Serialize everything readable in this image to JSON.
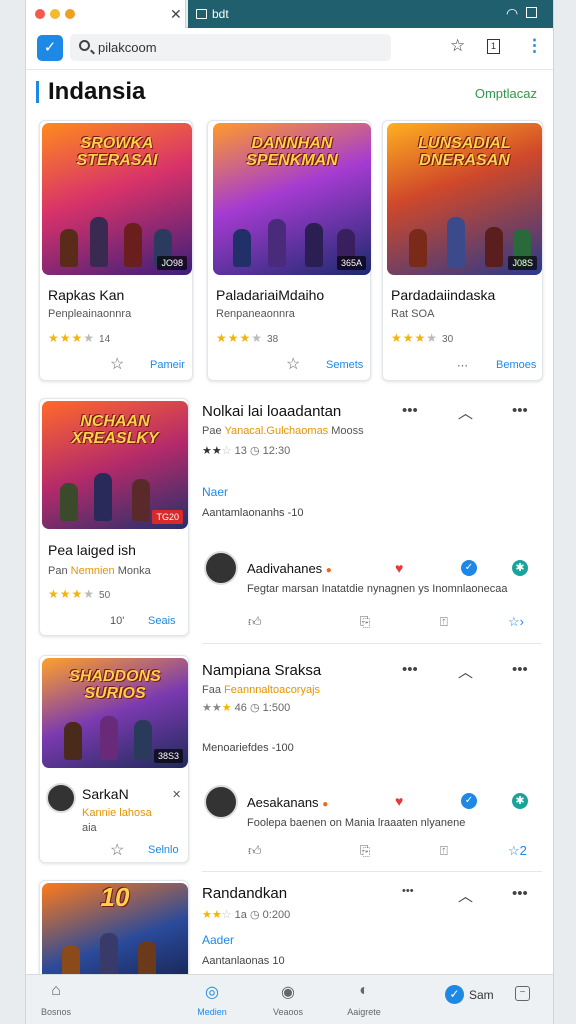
{
  "window": {
    "tab_title": "bdt",
    "search": {
      "value": "pilakcoom"
    }
  },
  "header": {
    "title": "Indansia",
    "link": "Omptlacaz"
  },
  "top_cards": [
    {
      "art_title": "SROWKA STERASAI",
      "badge": "JO98",
      "name": "Rapkas Kan",
      "sub": "Penpleainaonnra",
      "rating": "14",
      "action": "Pameir"
    },
    {
      "art_title": "DANNHAN SPENKMAN",
      "badge": "365A",
      "name": "PaladariaiMdaiho",
      "sub": "Renpaneaonnra",
      "rating": "38",
      "action": "Semets"
    },
    {
      "art_title": "LUNSADIAL DNERASAN",
      "badge": "J08S",
      "name": "Pardadaiindaska",
      "sub": "Rat SOA",
      "rating": "30",
      "action": "Bemoes"
    }
  ],
  "list_items": [
    {
      "art_title": "NCHAAN XREASLKY",
      "badge": "TG20",
      "card_name": "Pea laiged ish",
      "card_sub_prefix": "Pan",
      "card_sub_hl": "Nemnien",
      "card_sub_suffix": "Monka",
      "card_rating": "50",
      "card_rating_prefix": "10'",
      "card_action": "Seais",
      "title": "Nolkai lai loaadantan",
      "sub_prefix": "Pae",
      "sub_hl": "Yanacal.Gulchaomas",
      "sub_suffix": "Mooss",
      "rating": "13",
      "count": "12:30",
      "link": "Naer",
      "desc": "Aantamlaonanhs -10",
      "user": "Aadivahanes",
      "comment": "Fegtar marsan Inatatdie nynagnen ys Inomnlaonecaa"
    },
    {
      "art_title": "SHADDONS SURIOS",
      "badge": "38S3",
      "card_name": "SarkaN",
      "card_sub_prefix": "",
      "card_sub_hl": "Kannie lahosa",
      "card_sub_suffix": "aia",
      "card_action": "Selnlo",
      "title": "Nampiana Sraksa",
      "sub_prefix": "Faa",
      "sub_hl": "Feannnaltoacoryajs",
      "sub_suffix": "",
      "rating": "46",
      "count": "1:500",
      "desc": "Menoariefdes -100",
      "user": "Aesakanans",
      "comment": "Foolepa baenen on Mania lraaaten nlyanene"
    },
    {
      "art_title": "10",
      "badge": "",
      "title": "Randandkan",
      "rating": "1a",
      "count": "0:200",
      "link": "Aader",
      "desc": "Aantanlaonas 10"
    }
  ],
  "bottom_nav": [
    {
      "label": "Bosnos",
      "icon": "home-icon"
    },
    {
      "label": "Medien",
      "icon": "media-icon"
    },
    {
      "label": "Veaoos",
      "icon": "chat-icon"
    },
    {
      "label": "Aaigrete",
      "icon": "profile-icon"
    }
  ],
  "save_label": "Sam",
  "colors": {
    "accent": "#1e88e5",
    "link_green": "#2e9a46",
    "star": "#f5b400",
    "tab_dark": "#1f5f6e"
  }
}
